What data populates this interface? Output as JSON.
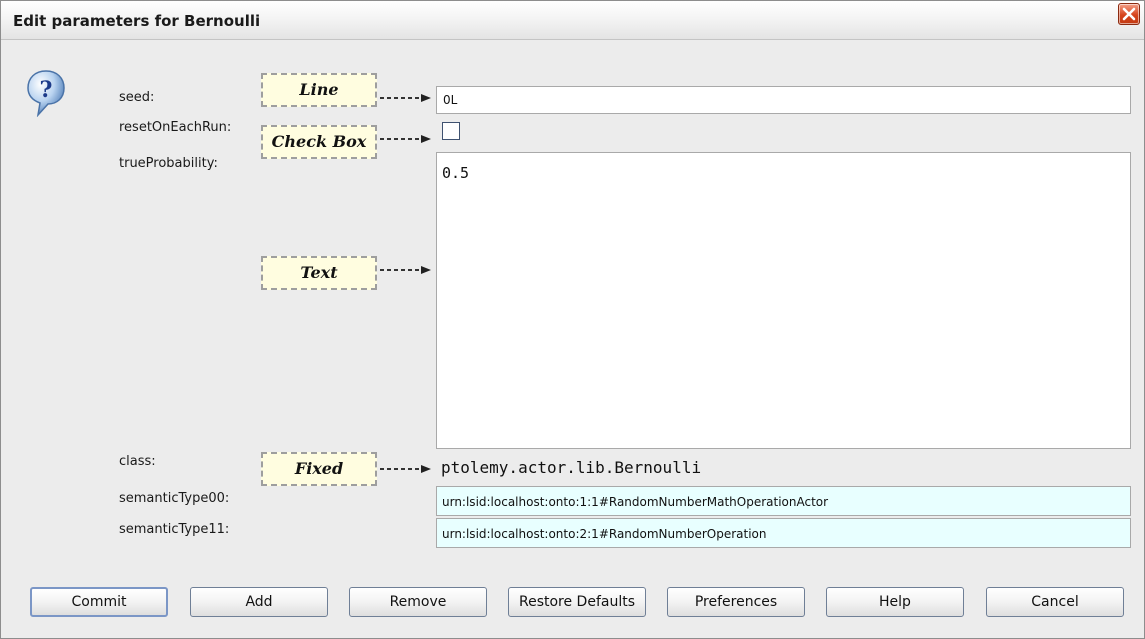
{
  "window": {
    "title": "Edit parameters for Bernoulli"
  },
  "icons": {
    "help": "help-question-icon",
    "close": "close-icon"
  },
  "fields": {
    "seed": {
      "label": "seed:",
      "value": "0L"
    },
    "resetOnEachRun": {
      "label": "resetOnEachRun:",
      "checked": false
    },
    "trueProbability": {
      "label": "trueProbability:",
      "value": "0.5"
    },
    "class": {
      "label": "class:",
      "value": "ptolemy.actor.lib.Bernoulli"
    },
    "semanticType00": {
      "label": "semanticType00:",
      "value": "urn:lsid:localhost:onto:1:1#RandomNumberMathOperationActor"
    },
    "semanticType11": {
      "label": "semanticType11:",
      "value": "urn:lsid:localhost:onto:2:1#RandomNumberOperation"
    }
  },
  "callouts": {
    "line": "Line",
    "checkbox": "Check Box",
    "text": "Text",
    "fixed": "Fixed"
  },
  "buttons": {
    "commit": "Commit",
    "add": "Add",
    "remove": "Remove",
    "restore": "Restore Defaults",
    "preferences": "Preferences",
    "help": "Help",
    "cancel": "Cancel"
  },
  "colors": {
    "semantic_field_bg": "#e8ffff",
    "callout_bg": "#fffde0",
    "close_button": "#d6441c"
  }
}
